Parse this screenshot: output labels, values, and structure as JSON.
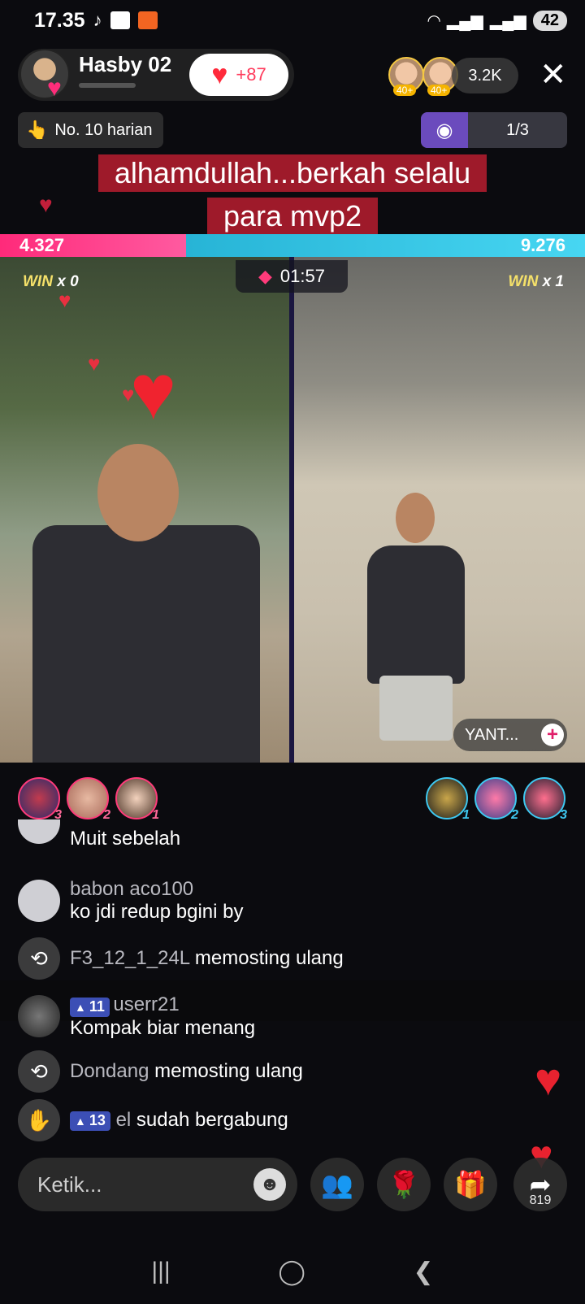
{
  "status": {
    "time": "17.35",
    "battery": "42",
    "icons": [
      "tiktok-icon",
      "hd-icon",
      "record-icon",
      "wifi-icon",
      "signal-icon",
      "signal-icon"
    ]
  },
  "host": {
    "name": "Hasby 02",
    "like_count": "+87",
    "rank_label": "No. 10 harian"
  },
  "viewers": {
    "badges": [
      "40+",
      "40+"
    ],
    "count": "3.2K"
  },
  "game": {
    "progress": "1/3"
  },
  "caption": {
    "line1": "alhamdullah...berkah selalu",
    "line2": "para mvp2"
  },
  "battle": {
    "left_score": "4.327",
    "right_score": "9.276",
    "left_share": 0.318,
    "timer": "01:57",
    "left_win_word": "WIN",
    "left_win_count": "x 0",
    "right_win_word": "WIN",
    "right_win_count": "x 1",
    "guest_name": "YANT..."
  },
  "supporters": {
    "left_ranks": [
      "3",
      "2",
      "1"
    ],
    "right_ranks": [
      "1",
      "2",
      "3"
    ]
  },
  "chat": [
    {
      "type": "message",
      "name": "",
      "message": "Muit sebelah"
    },
    {
      "type": "message",
      "name": "babon aco100",
      "message": "ko jdi redup bgini by"
    },
    {
      "type": "repost",
      "name": "F3_12_1_24L",
      "message": "memosting ulang"
    },
    {
      "type": "message",
      "level": "11",
      "name": "userr21",
      "message": "Kompak biar menang"
    },
    {
      "type": "repost",
      "name": "Dondang",
      "message": "memosting ulang"
    },
    {
      "type": "join",
      "level": "13",
      "name": "el",
      "message": "sudah bergabung"
    }
  ],
  "bottom": {
    "input_placeholder": "Ketik...",
    "share_count": "819"
  },
  "colors": {
    "pink_team": "#ff2a7a",
    "blue_team": "#3ec8f0",
    "caption_bg": "#9e1a2a",
    "heart": "#ff2a3b"
  }
}
